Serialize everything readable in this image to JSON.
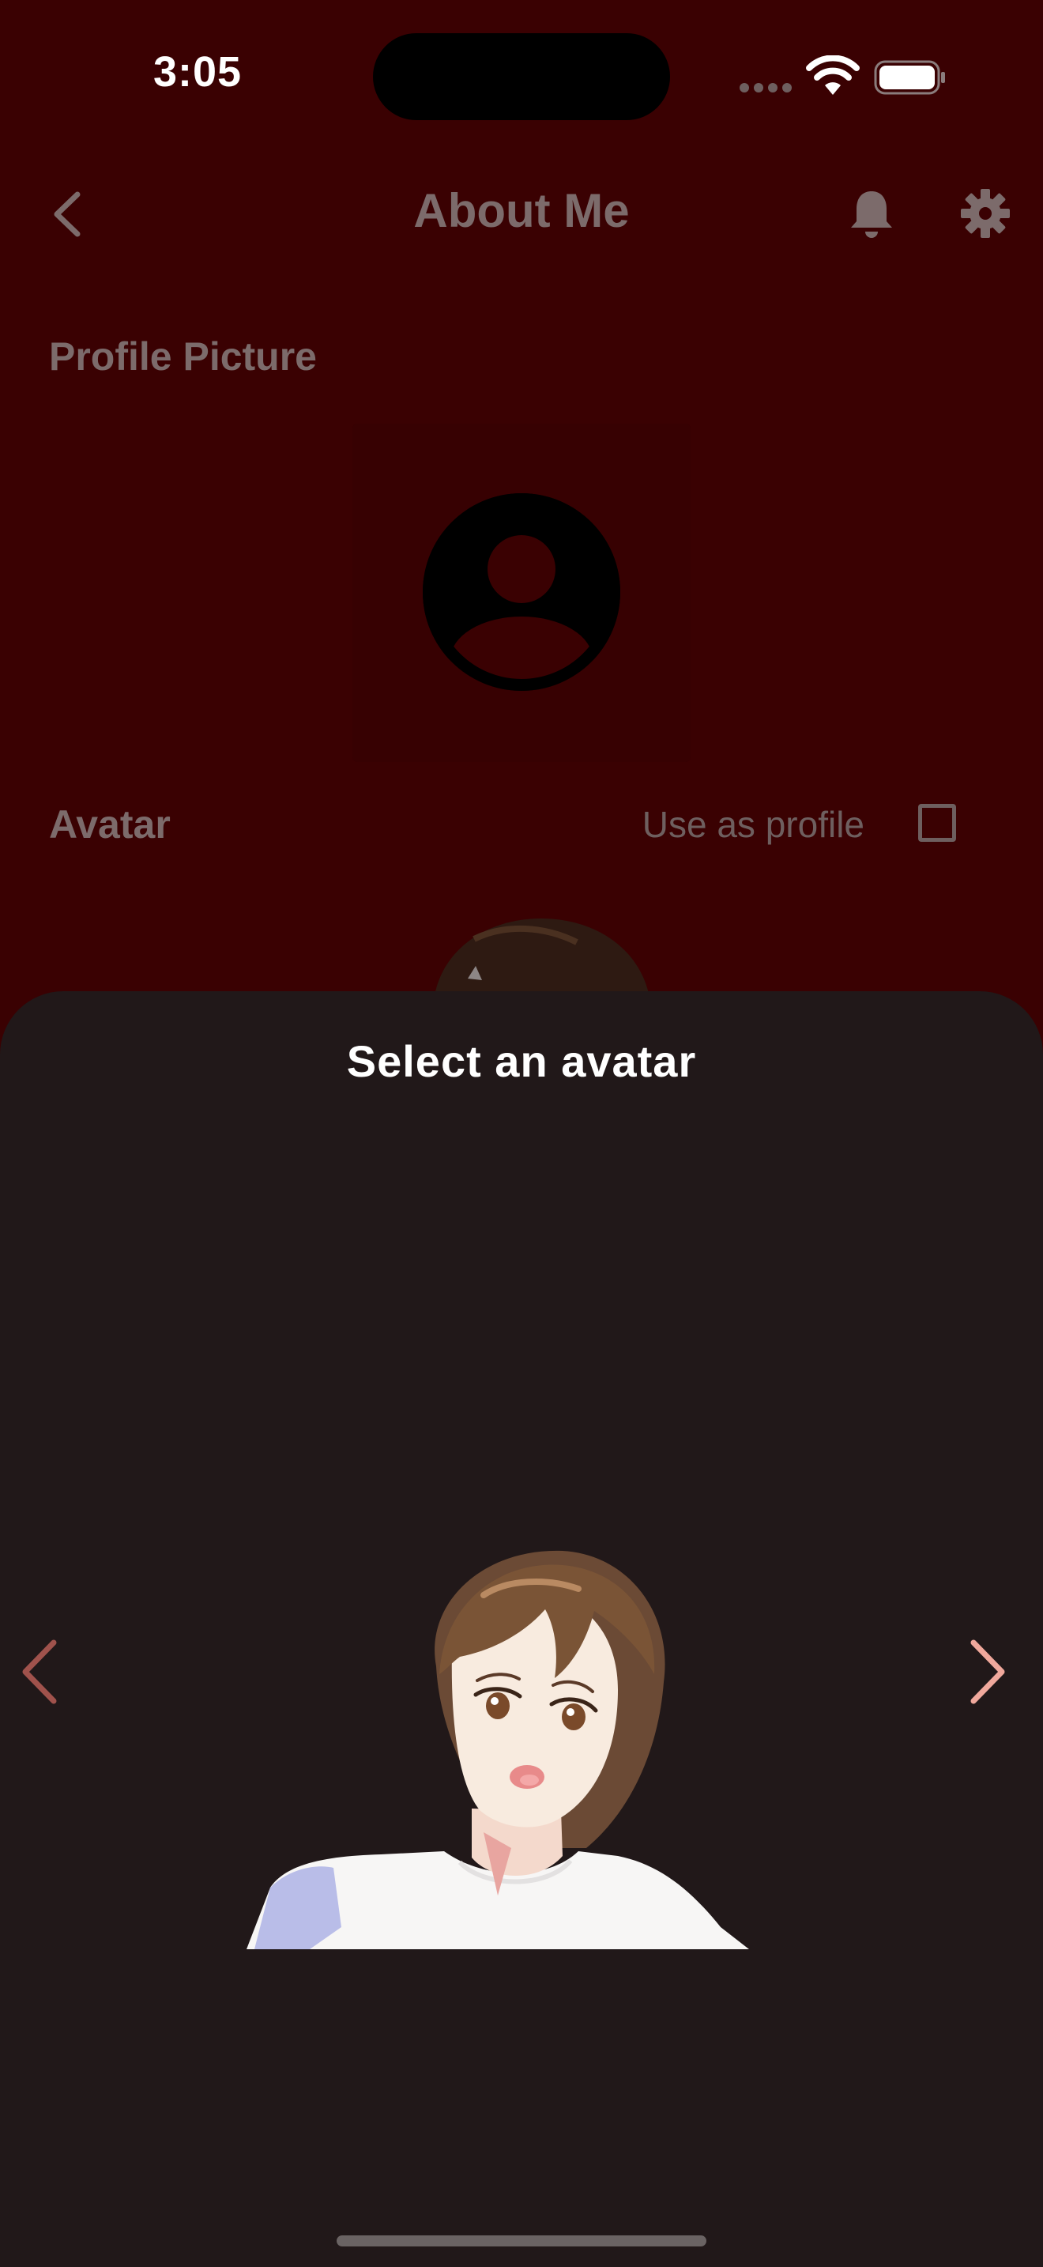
{
  "status_bar": {
    "time": "3:05",
    "icons": [
      "signal-dots-icon",
      "wifi-icon",
      "battery-icon"
    ]
  },
  "header": {
    "back_icon": "chevron-left-icon",
    "title": "About Me",
    "notifications_icon": "bell-icon",
    "settings_icon": "gear-icon"
  },
  "profile_picture": {
    "heading": "Profile Picture",
    "placeholder_icon": "account-circle-icon"
  },
  "avatar_section": {
    "heading": "Avatar",
    "use_as_profile_label": "Use as profile",
    "use_as_profile_checked": false
  },
  "avatar_sheet": {
    "title": "Select an avatar",
    "prev_icon": "chevron-left-icon",
    "next_icon": "chevron-right-icon",
    "avatar_image": "avatar-preview"
  },
  "colors": {
    "background": "#3a0102",
    "sheet": "#211819",
    "muted_text": "#7c6b6b",
    "chevron_prev": "#a0524c",
    "chevron_next": "#f0a89c"
  }
}
